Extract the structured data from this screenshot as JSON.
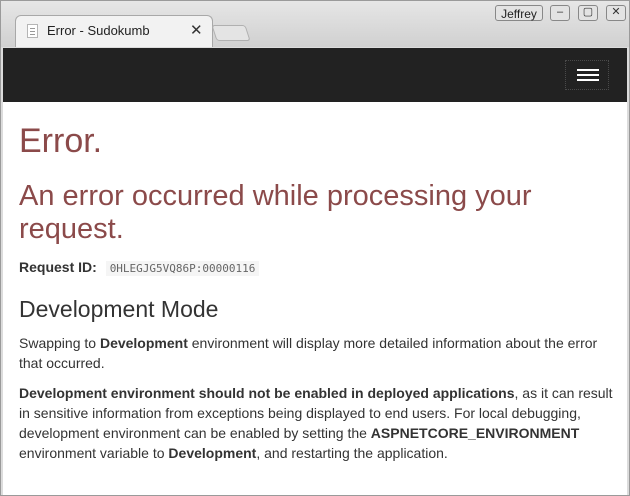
{
  "browser": {
    "tab_title": "Error - Sudokumb",
    "tab_close": "✕",
    "profile_name": "Jeffrey",
    "min_label": "–",
    "max_label": "▢",
    "close_label": "✕"
  },
  "navbar": {
    "background": "#222222",
    "toggler_icon": "hamburger-menu-icon"
  },
  "page": {
    "title": "Error.",
    "subtitle": "An error occurred while processing your request.",
    "request_id_label": "Request ID:",
    "request_id_value": "0HLEGJG5VQ86P:00000116",
    "dev_heading": "Development Mode",
    "p1": {
      "pre": "Swapping to ",
      "bold": "Development",
      "post": " environment will display more detailed information about the error that occurred."
    },
    "p2": {
      "bold1": "Development environment should not be enabled in deployed applications",
      "mid1": ", as it can result in sensitive information from exceptions being displayed to end users. For local debugging, development environment can be enabled by setting the ",
      "bold2": "ASPNETCORE_ENVIRONMENT",
      "mid2": " environment variable to ",
      "bold3": "Development",
      "end": ", and restarting the application."
    },
    "error_color": "#8b4a4a"
  }
}
